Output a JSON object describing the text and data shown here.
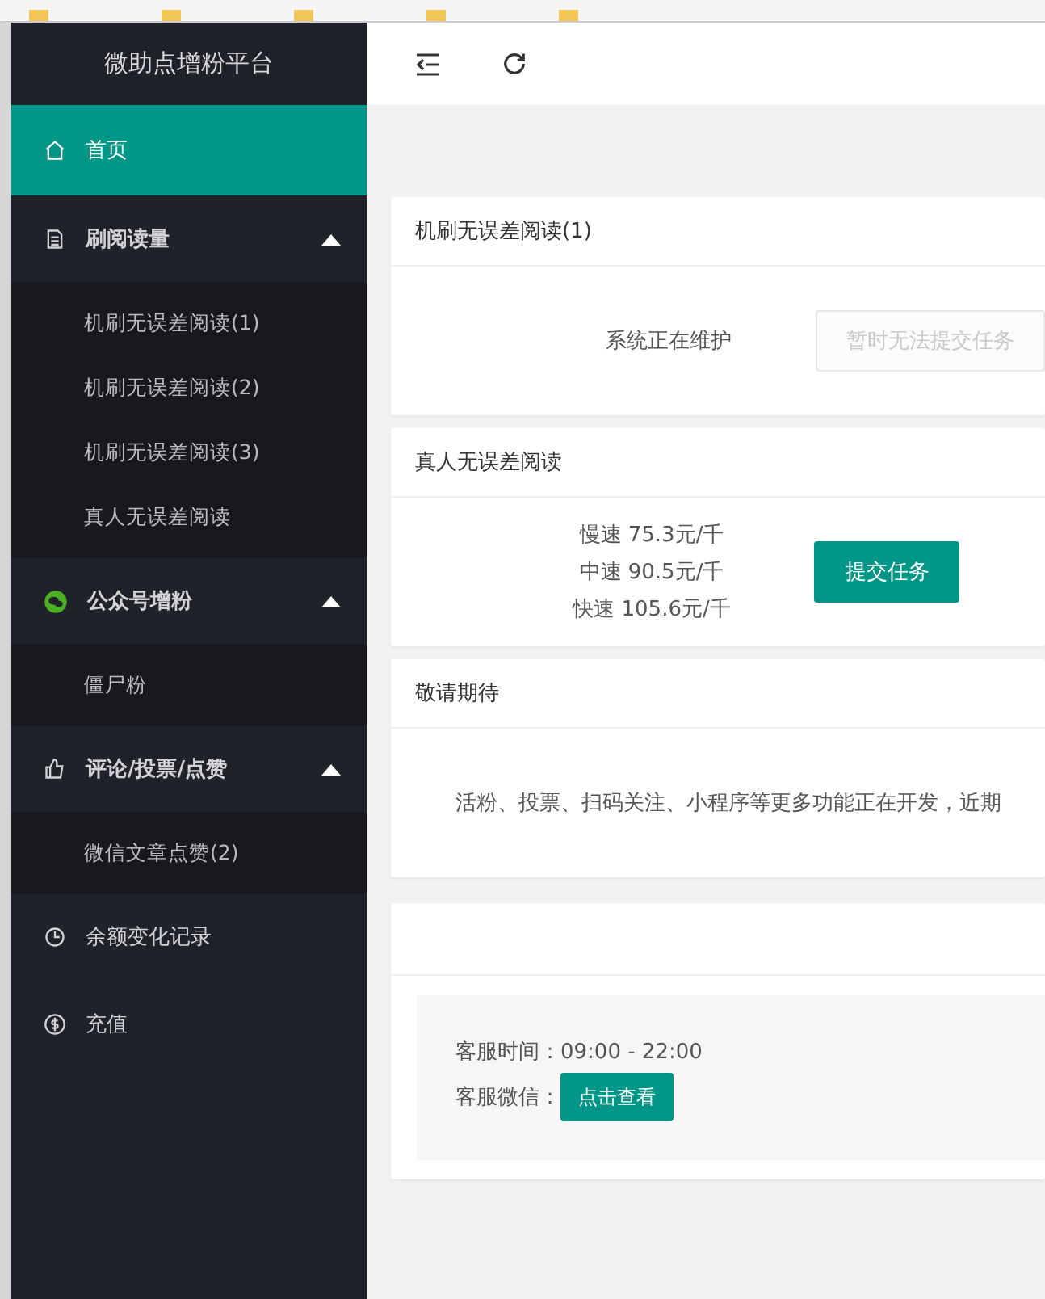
{
  "sidebar": {
    "title": "微助点增粉平台",
    "items": [
      {
        "kind": "link",
        "label": "首页",
        "selected": true
      },
      {
        "kind": "group",
        "label": "刷阅读量",
        "expanded": true,
        "children": [
          {
            "label": "机刷无误差阅读(1)",
            "selected": false
          },
          {
            "label": "机刷无误差阅读(2)",
            "selected": false
          },
          {
            "label": "机刷无误差阅读(3)",
            "selected": false
          },
          {
            "label": "真人无误差阅读",
            "selected": false
          }
        ]
      },
      {
        "kind": "group",
        "label": "公众号增粉",
        "expanded": true,
        "children": [
          {
            "label": "僵尸粉",
            "selected": false
          }
        ]
      },
      {
        "kind": "group",
        "label": "评论/投票/点赞",
        "expanded": true,
        "children": [
          {
            "label": "微信文章点赞(2)",
            "selected": false
          }
        ]
      },
      {
        "kind": "link",
        "label": "余额变化记录",
        "selected": false
      },
      {
        "kind": "link",
        "label": "充值",
        "selected": false
      }
    ]
  },
  "cards": [
    {
      "kind": "status",
      "title": "机刷无误差阅读(1)",
      "message": "系统正在维护",
      "button": {
        "label": "暂时无法提交任务",
        "disabled": true
      }
    },
    {
      "kind": "prices",
      "title": "真人无误差阅读",
      "prices": [
        "慢速 75.3元/千",
        "中速 90.5元/千",
        "快速 105.6元/千"
      ],
      "button": {
        "label": "提交任务",
        "disabled": false
      }
    },
    {
      "kind": "notice",
      "title": "敬请期待",
      "message": "活粉、投票、扫码关注、小程序等更多功能正在开发，近期"
    },
    {
      "kind": "contact",
      "hours": "客服时间：09:00 - 22:00",
      "wechat_label": "客服微信：",
      "button": {
        "label": "点击查看",
        "disabled": false
      }
    }
  ]
}
